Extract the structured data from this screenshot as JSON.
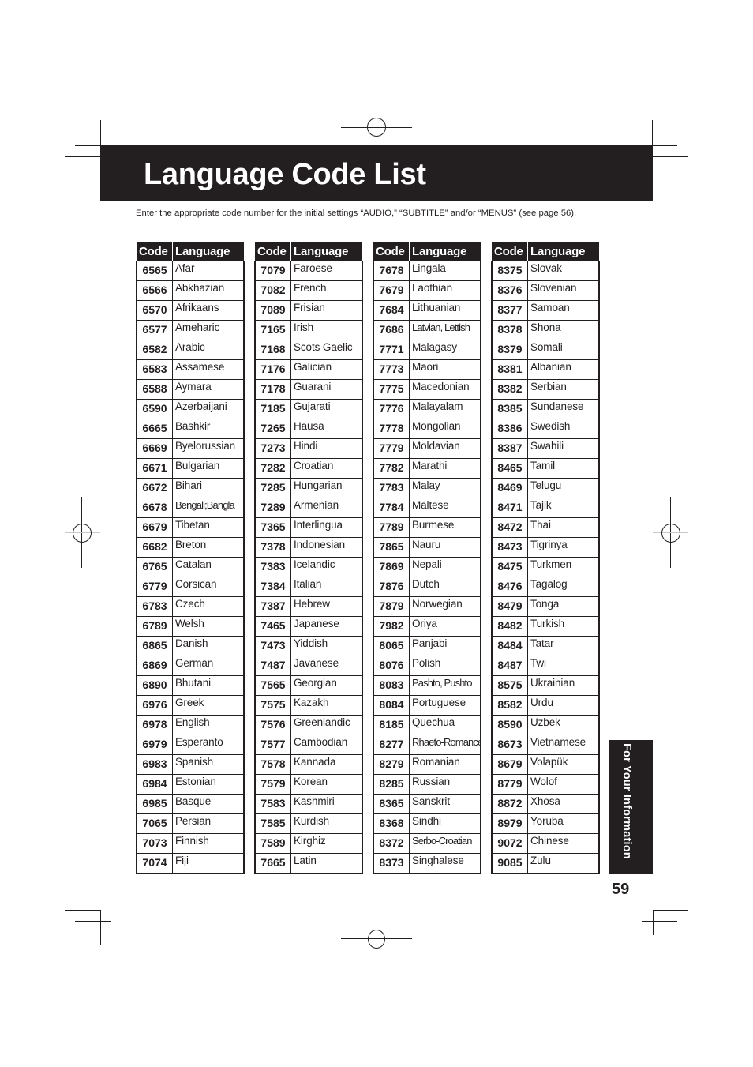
{
  "header": {
    "title": "Language Code List"
  },
  "intro_text": "Enter the appropriate code number for the initial settings “AUDIO,” “SUBTITLE” and/or “MENUS” (see page 56).",
  "table_headers": {
    "code": "Code",
    "language": "Language"
  },
  "columns": [
    [
      {
        "code": "6565",
        "language": "Afar"
      },
      {
        "code": "6566",
        "language": "Abkhazian"
      },
      {
        "code": "6570",
        "language": "Afrikaans"
      },
      {
        "code": "6577",
        "language": "Ameharic"
      },
      {
        "code": "6582",
        "language": "Arabic"
      },
      {
        "code": "6583",
        "language": "Assamese"
      },
      {
        "code": "6588",
        "language": "Aymara"
      },
      {
        "code": "6590",
        "language": "Azerbaijani"
      },
      {
        "code": "6665",
        "language": "Bashkir"
      },
      {
        "code": "6669",
        "language": "Byelorussian"
      },
      {
        "code": "6671",
        "language": "Bulgarian"
      },
      {
        "code": "6672",
        "language": "Bihari"
      },
      {
        "code": "6678",
        "language": "Bengali;Bangla"
      },
      {
        "code": "6679",
        "language": "Tibetan"
      },
      {
        "code": "6682",
        "language": "Breton"
      },
      {
        "code": "6765",
        "language": "Catalan"
      },
      {
        "code": "6779",
        "language": "Corsican"
      },
      {
        "code": "6783",
        "language": "Czech"
      },
      {
        "code": "6789",
        "language": "Welsh"
      },
      {
        "code": "6865",
        "language": "Danish"
      },
      {
        "code": "6869",
        "language": "German"
      },
      {
        "code": "6890",
        "language": "Bhutani"
      },
      {
        "code": "6976",
        "language": "Greek"
      },
      {
        "code": "6978",
        "language": "English"
      },
      {
        "code": "6979",
        "language": "Esperanto"
      },
      {
        "code": "6983",
        "language": "Spanish"
      },
      {
        "code": "6984",
        "language": "Estonian"
      },
      {
        "code": "6985",
        "language": "Basque"
      },
      {
        "code": "7065",
        "language": "Persian"
      },
      {
        "code": "7073",
        "language": "Finnish"
      },
      {
        "code": "7074",
        "language": "Fiji"
      }
    ],
    [
      {
        "code": "7079",
        "language": "Faroese"
      },
      {
        "code": "7082",
        "language": "French"
      },
      {
        "code": "7089",
        "language": "Frisian"
      },
      {
        "code": "7165",
        "language": "Irish"
      },
      {
        "code": "7168",
        "language": "Scots Gaelic"
      },
      {
        "code": "7176",
        "language": "Galician"
      },
      {
        "code": "7178",
        "language": "Guarani"
      },
      {
        "code": "7185",
        "language": "Gujarati"
      },
      {
        "code": "7265",
        "language": "Hausa"
      },
      {
        "code": "7273",
        "language": "Hindi"
      },
      {
        "code": "7282",
        "language": "Croatian"
      },
      {
        "code": "7285",
        "language": "Hungarian"
      },
      {
        "code": "7289",
        "language": "Armenian"
      },
      {
        "code": "7365",
        "language": "Interlingua"
      },
      {
        "code": "7378",
        "language": "Indonesian"
      },
      {
        "code": "7383",
        "language": "Icelandic"
      },
      {
        "code": "7384",
        "language": "Italian"
      },
      {
        "code": "7387",
        "language": "Hebrew"
      },
      {
        "code": "7465",
        "language": "Japanese"
      },
      {
        "code": "7473",
        "language": "Yiddish"
      },
      {
        "code": "7487",
        "language": "Javanese"
      },
      {
        "code": "7565",
        "language": "Georgian"
      },
      {
        "code": "7575",
        "language": "Kazakh"
      },
      {
        "code": "7576",
        "language": "Greenlandic"
      },
      {
        "code": "7577",
        "language": "Cambodian"
      },
      {
        "code": "7578",
        "language": "Kannada"
      },
      {
        "code": "7579",
        "language": "Korean"
      },
      {
        "code": "7583",
        "language": "Kashmiri"
      },
      {
        "code": "7585",
        "language": "Kurdish"
      },
      {
        "code": "7589",
        "language": "Kirghiz"
      },
      {
        "code": "7665",
        "language": "Latin"
      }
    ],
    [
      {
        "code": "7678",
        "language": "Lingala"
      },
      {
        "code": "7679",
        "language": "Laothian"
      },
      {
        "code": "7684",
        "language": "Lithuanian"
      },
      {
        "code": "7686",
        "language": "Latvian, Lettish"
      },
      {
        "code": "7771",
        "language": "Malagasy"
      },
      {
        "code": "7773",
        "language": "Maori"
      },
      {
        "code": "7775",
        "language": "Macedonian"
      },
      {
        "code": "7776",
        "language": "Malayalam"
      },
      {
        "code": "7778",
        "language": "Mongolian"
      },
      {
        "code": "7779",
        "language": "Moldavian"
      },
      {
        "code": "7782",
        "language": "Marathi"
      },
      {
        "code": "7783",
        "language": "Malay"
      },
      {
        "code": "7784",
        "language": "Maltese"
      },
      {
        "code": "7789",
        "language": "Burmese"
      },
      {
        "code": "7865",
        "language": "Nauru"
      },
      {
        "code": "7869",
        "language": "Nepali"
      },
      {
        "code": "7876",
        "language": "Dutch"
      },
      {
        "code": "7879",
        "language": "Norwegian"
      },
      {
        "code": "7982",
        "language": "Oriya"
      },
      {
        "code": "8065",
        "language": "Panjabi"
      },
      {
        "code": "8076",
        "language": "Polish"
      },
      {
        "code": "8083",
        "language": "Pashto, Pushto"
      },
      {
        "code": "8084",
        "language": "Portuguese"
      },
      {
        "code": "8185",
        "language": "Quechua"
      },
      {
        "code": "8277",
        "language": "Rhaeto-Romance"
      },
      {
        "code": "8279",
        "language": "Romanian"
      },
      {
        "code": "8285",
        "language": "Russian"
      },
      {
        "code": "8365",
        "language": "Sanskrit"
      },
      {
        "code": "8368",
        "language": "Sindhi"
      },
      {
        "code": "8372",
        "language": "Serbo-Croatian"
      },
      {
        "code": "8373",
        "language": "Singhalese"
      }
    ],
    [
      {
        "code": "8375",
        "language": "Slovak"
      },
      {
        "code": "8376",
        "language": "Slovenian"
      },
      {
        "code": "8377",
        "language": "Samoan"
      },
      {
        "code": "8378",
        "language": "Shona"
      },
      {
        "code": "8379",
        "language": "Somali"
      },
      {
        "code": "8381",
        "language": "Albanian"
      },
      {
        "code": "8382",
        "language": "Serbian"
      },
      {
        "code": "8385",
        "language": "Sundanese"
      },
      {
        "code": "8386",
        "language": "Swedish"
      },
      {
        "code": "8387",
        "language": "Swahili"
      },
      {
        "code": "8465",
        "language": "Tamil"
      },
      {
        "code": "8469",
        "language": "Telugu"
      },
      {
        "code": "8471",
        "language": "Tajik"
      },
      {
        "code": "8472",
        "language": "Thai"
      },
      {
        "code": "8473",
        "language": "Tigrinya"
      },
      {
        "code": "8475",
        "language": "Turkmen"
      },
      {
        "code": "8476",
        "language": "Tagalog"
      },
      {
        "code": "8479",
        "language": "Tonga"
      },
      {
        "code": "8482",
        "language": "Turkish"
      },
      {
        "code": "8484",
        "language": "Tatar"
      },
      {
        "code": "8487",
        "language": "Twi"
      },
      {
        "code": "8575",
        "language": "Ukrainian"
      },
      {
        "code": "8582",
        "language": "Urdu"
      },
      {
        "code": "8590",
        "language": "Uzbek"
      },
      {
        "code": "8673",
        "language": "Vietnamese"
      },
      {
        "code": "8679",
        "language": "Volapük"
      },
      {
        "code": "8779",
        "language": "Wolof"
      },
      {
        "code": "8872",
        "language": "Xhosa"
      },
      {
        "code": "8979",
        "language": "Yoruba"
      },
      {
        "code": "9072",
        "language": "Chinese"
      },
      {
        "code": "9085",
        "language": "Zulu"
      }
    ]
  ],
  "side_tab": {
    "label": "For Your Information"
  },
  "footer": {
    "page_number": "59"
  },
  "colors": {
    "dark": "#231f20",
    "paper": "#ffffff"
  }
}
